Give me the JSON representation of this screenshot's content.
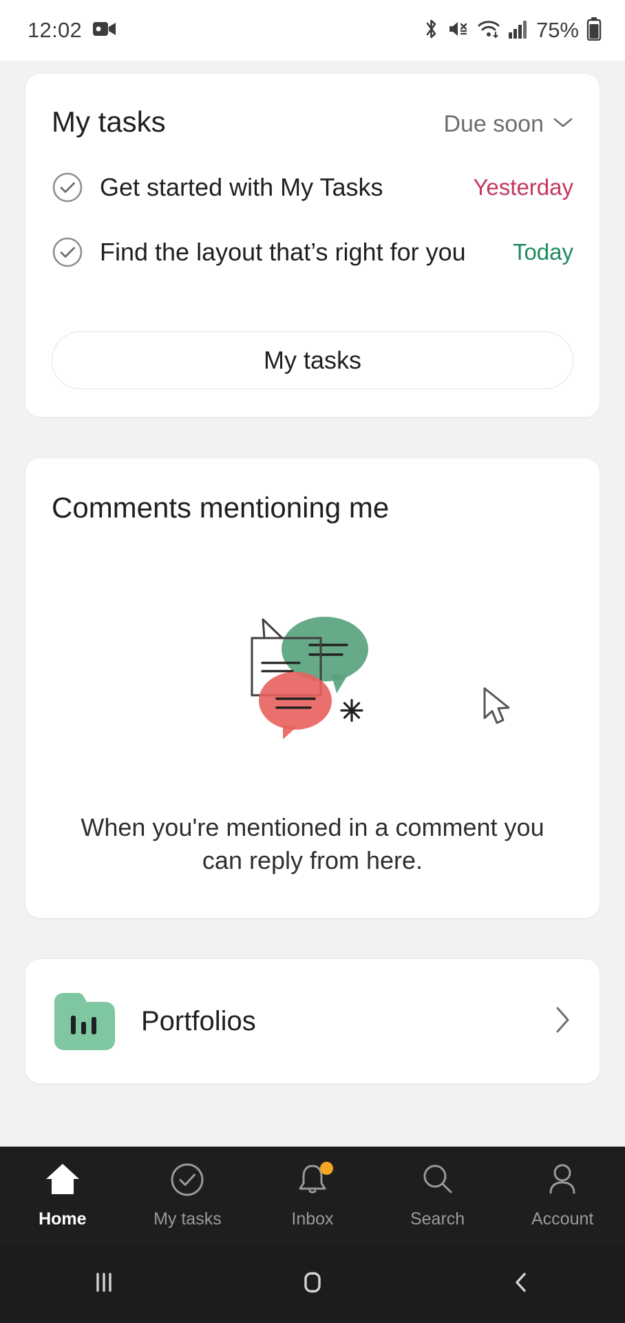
{
  "status_bar": {
    "time": "12:02",
    "battery_percent": "75%",
    "icons": [
      "video-camera-icon",
      "bluetooth-icon",
      "mute-icon",
      "wifi-icon",
      "cellular-signal-icon",
      "battery-icon"
    ]
  },
  "my_tasks_card": {
    "title": "My tasks",
    "filter_label": "Due soon",
    "tasks": [
      {
        "name": "Get started with My Tasks",
        "due": "Yesterday",
        "due_color": "#c4385f"
      },
      {
        "name": "Find the layout that’s right for you",
        "due": "Today",
        "due_color": "#1e8a5f"
      }
    ],
    "button_label": "My tasks"
  },
  "comments_card": {
    "title": "Comments mentioning me",
    "empty_text": "When you're mentioned in a comment you can reply from here.",
    "illustration": {
      "green": "#5aa37e",
      "red": "#e8615d",
      "outline": "#3f3f3f"
    }
  },
  "portfolios_card": {
    "label": "Portfolios",
    "icon_color": "#7fc7a1",
    "chevron": "chevron-right-icon"
  },
  "bottom_nav": {
    "items": [
      {
        "label": "Home",
        "icon": "home-icon",
        "active": true
      },
      {
        "label": "My tasks",
        "icon": "check-circle-icon",
        "active": false
      },
      {
        "label": "Inbox",
        "icon": "bell-icon",
        "active": false,
        "badge": true
      },
      {
        "label": "Search",
        "icon": "search-icon",
        "active": false
      },
      {
        "label": "Account",
        "icon": "person-icon",
        "active": false
      }
    ],
    "active_color": "#ffffff",
    "inactive_color": "#9a9a9a",
    "badge_color": "#f5a623"
  },
  "system_nav": {
    "items": [
      {
        "name": "recents-button",
        "icon": "recents-icon"
      },
      {
        "name": "home-button",
        "icon": "home-square-icon"
      },
      {
        "name": "back-button",
        "icon": "chevron-left-icon"
      }
    ]
  },
  "cursor": {
    "name": "mouse-pointer"
  }
}
